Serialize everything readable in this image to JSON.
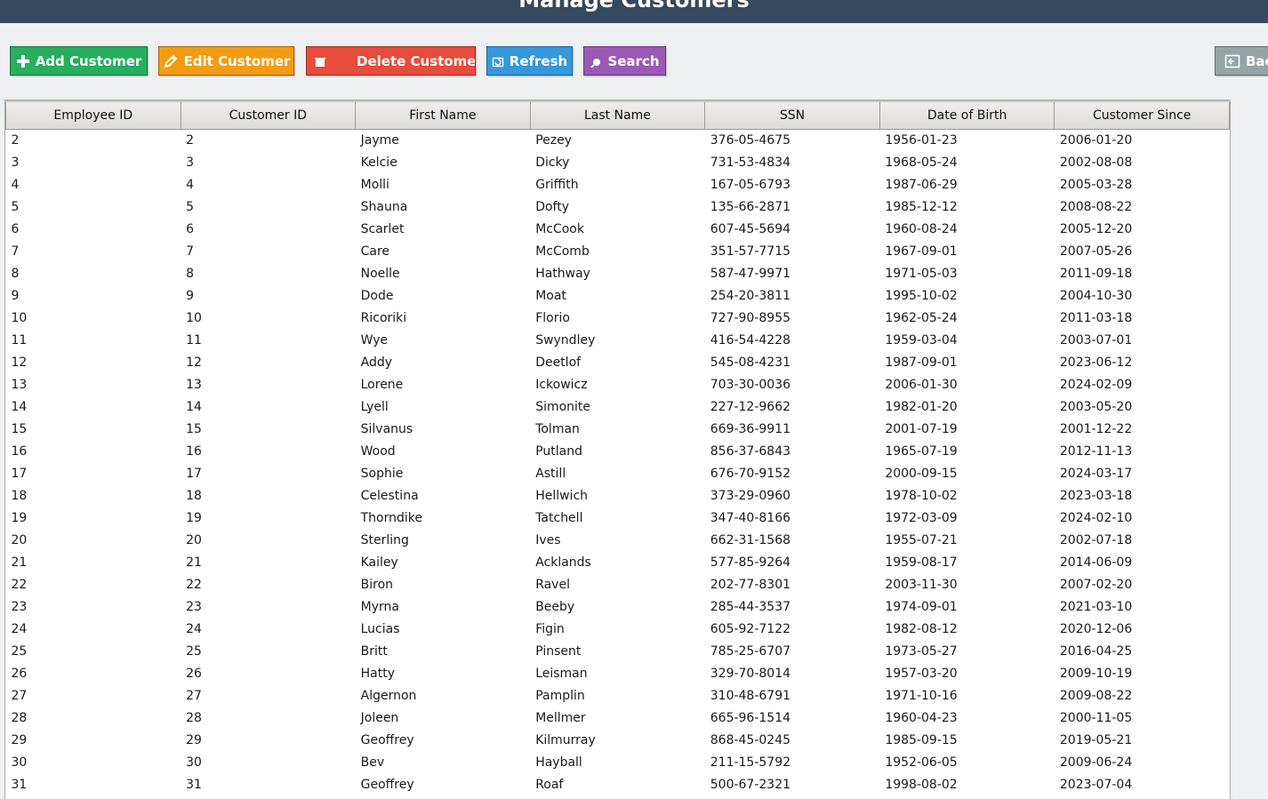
{
  "window": {
    "title": "Manage Customers"
  },
  "toolbar": {
    "add_label": "Add Customer",
    "edit_label": "Edit Customer",
    "delete_label": "Delete Customer",
    "refresh_label": "Refresh",
    "search_label": "Search",
    "back_label": "Back",
    "colors": {
      "add": "#27ae60",
      "edit": "#f39c12",
      "delete": "#e74c3c",
      "refresh": "#3498db",
      "search": "#9b59b6",
      "back": "#95a5a6"
    },
    "icons": {
      "add": "plus-icon",
      "edit": "pencil-icon",
      "delete": "trash-icon",
      "refresh": "refresh-icon",
      "search": "search-icon",
      "back": "back-icon"
    }
  },
  "table": {
    "columns": [
      "Employee ID",
      "Customer ID",
      "First Name",
      "Last Name",
      "SSN",
      "Date of Birth",
      "Customer Since"
    ],
    "rows": [
      [
        "2",
        "2",
        "Jayme",
        "Pezey",
        "376-05-4675",
        "1956-01-23",
        "2006-01-20"
      ],
      [
        "3",
        "3",
        "Kelcie",
        "Dicky",
        "731-53-4834",
        "1968-05-24",
        "2002-08-08"
      ],
      [
        "4",
        "4",
        "Molli",
        "Griffith",
        "167-05-6793",
        "1987-06-29",
        "2005-03-28"
      ],
      [
        "5",
        "5",
        "Shauna",
        "Dofty",
        "135-66-2871",
        "1985-12-12",
        "2008-08-22"
      ],
      [
        "6",
        "6",
        "Scarlet",
        "McCook",
        "607-45-5694",
        "1960-08-24",
        "2005-12-20"
      ],
      [
        "7",
        "7",
        "Care",
        "McComb",
        "351-57-7715",
        "1967-09-01",
        "2007-05-26"
      ],
      [
        "8",
        "8",
        "Noelle",
        "Hathway",
        "587-47-9971",
        "1971-05-03",
        "2011-09-18"
      ],
      [
        "9",
        "9",
        "Dode",
        "Moat",
        "254-20-3811",
        "1995-10-02",
        "2004-10-30"
      ],
      [
        "10",
        "10",
        "Ricoriki",
        "Florio",
        "727-90-8955",
        "1962-05-24",
        "2011-03-18"
      ],
      [
        "11",
        "11",
        "Wye",
        "Swyndley",
        "416-54-4228",
        "1959-03-04",
        "2003-07-01"
      ],
      [
        "12",
        "12",
        "Addy",
        "Deetlof",
        "545-08-4231",
        "1987-09-01",
        "2023-06-12"
      ],
      [
        "13",
        "13",
        "Lorene",
        "Ickowicz",
        "703-30-0036",
        "2006-01-30",
        "2024-02-09"
      ],
      [
        "14",
        "14",
        "Lyell",
        "Simonite",
        "227-12-9662",
        "1982-01-20",
        "2003-05-20"
      ],
      [
        "15",
        "15",
        "Silvanus",
        "Tolman",
        "669-36-9911",
        "2001-07-19",
        "2001-12-22"
      ],
      [
        "16",
        "16",
        "Wood",
        "Putland",
        "856-37-6843",
        "1965-07-19",
        "2012-11-13"
      ],
      [
        "17",
        "17",
        "Sophie",
        "Astill",
        "676-70-9152",
        "2000-09-15",
        "2024-03-17"
      ],
      [
        "18",
        "18",
        "Celestina",
        "Hellwich",
        "373-29-0960",
        "1978-10-02",
        "2023-03-18"
      ],
      [
        "19",
        "19",
        "Thorndike",
        "Tatchell",
        "347-40-8166",
        "1972-03-09",
        "2024-02-10"
      ],
      [
        "20",
        "20",
        "Sterling",
        "Ives",
        "662-31-1568",
        "1955-07-21",
        "2002-07-18"
      ],
      [
        "21",
        "21",
        "Kailey",
        "Acklands",
        "577-85-9264",
        "1959-08-17",
        "2014-06-09"
      ],
      [
        "22",
        "22",
        "Biron",
        "Ravel",
        "202-77-8301",
        "2003-11-30",
        "2007-02-20"
      ],
      [
        "23",
        "23",
        "Myrna",
        "Beeby",
        "285-44-3537",
        "1974-09-01",
        "2021-03-10"
      ],
      [
        "24",
        "24",
        "Lucias",
        "Figin",
        "605-92-7122",
        "1982-08-12",
        "2020-12-06"
      ],
      [
        "25",
        "25",
        "Britt",
        "Pinsent",
        "785-25-6707",
        "1973-05-27",
        "2016-04-25"
      ],
      [
        "26",
        "26",
        "Hatty",
        "Leisman",
        "329-70-8014",
        "1957-03-20",
        "2009-10-19"
      ],
      [
        "27",
        "27",
        "Algernon",
        "Pamplin",
        "310-48-6791",
        "1971-10-16",
        "2009-08-22"
      ],
      [
        "28",
        "28",
        "Joleen",
        "Mellmer",
        "665-96-1514",
        "1960-04-23",
        "2000-11-05"
      ],
      [
        "29",
        "29",
        "Geoffrey",
        "Kilmurray",
        "868-45-0245",
        "1985-09-15",
        "2019-05-21"
      ],
      [
        "30",
        "30",
        "Bev",
        "Hayball",
        "211-15-5792",
        "1952-06-05",
        "2009-06-24"
      ],
      [
        "31",
        "31",
        "Geoffrey",
        "Roaf",
        "500-67-2321",
        "1998-08-02",
        "2023-07-04"
      ]
    ]
  }
}
